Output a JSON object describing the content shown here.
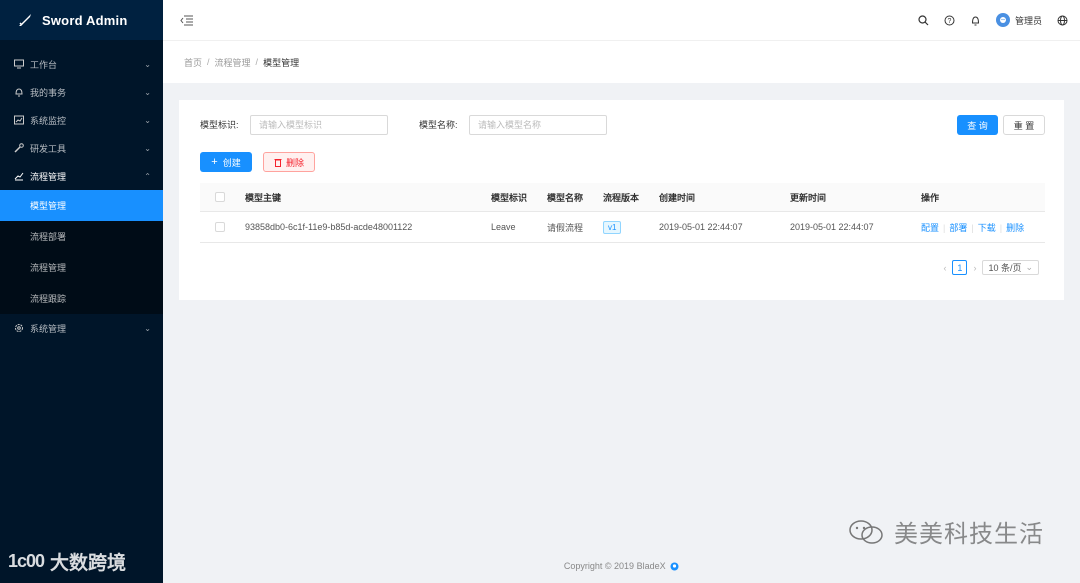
{
  "app": {
    "title": "Sword Admin"
  },
  "sidebar": {
    "items": [
      {
        "label": "工作台",
        "icon": "monitor-icon"
      },
      {
        "label": "我的事务",
        "icon": "bell-icon"
      },
      {
        "label": "系统监控",
        "icon": "chart-box-icon"
      },
      {
        "label": "研发工具",
        "icon": "tool-icon"
      },
      {
        "label": "流程管理",
        "icon": "line-chart-icon"
      }
    ],
    "submenu": [
      {
        "label": "模型管理"
      },
      {
        "label": "流程部署"
      },
      {
        "label": "流程管理"
      },
      {
        "label": "流程跟踪"
      }
    ],
    "after": [
      {
        "label": "系统管理",
        "icon": "gear-icon"
      }
    ]
  },
  "header": {
    "user_name": "管理员"
  },
  "breadcrumb": {
    "items": [
      "首页",
      "流程管理",
      "模型管理"
    ]
  },
  "filters": {
    "model_key_label": "模型标识:",
    "model_key_placeholder": "请输入模型标识",
    "model_name_label": "模型名称:",
    "model_name_placeholder": "请输入模型名称",
    "search_label": "查 询",
    "reset_label": "重 置"
  },
  "actions": {
    "create_label": "创建",
    "delete_label": "删除"
  },
  "table": {
    "headers": {
      "id": "模型主键",
      "key": "模型标识",
      "name": "模型名称",
      "version": "流程版本",
      "created": "创建时间",
      "updated": "更新时间",
      "ops": "操作"
    },
    "rows": [
      {
        "id": "93858db0-6c1f-11e9-b85d-acde48001122",
        "key": "Leave",
        "name": "请假流程",
        "version": "v1",
        "created": "2019-05-01 22:44:07",
        "updated": "2019-05-01 22:44:07",
        "ops": [
          "配置",
          "部署",
          "下载",
          "删除"
        ]
      }
    ]
  },
  "pagination": {
    "current": "1",
    "page_size": "10 条/页"
  },
  "footer": {
    "text": "Copyright © 2019 BladeX"
  },
  "watermarks": {
    "left": "大数跨境",
    "left_mark": "1ᴄ00",
    "right": "美美科技生活"
  }
}
